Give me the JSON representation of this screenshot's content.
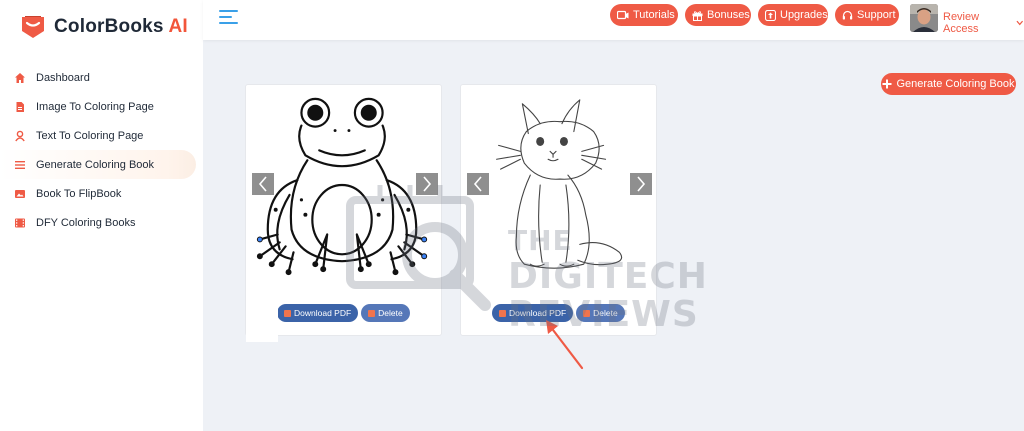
{
  "app": {
    "brand_main": "ColorBooks",
    "brand_accent": "AI",
    "accent_color": "#ef5a45"
  },
  "sidebar": {
    "items": [
      {
        "label": "Dashboard",
        "icon": "home-icon"
      },
      {
        "label": "Image To Coloring Page",
        "icon": "file-icon"
      },
      {
        "label": "Text To Coloring Page",
        "icon": "user-icon"
      },
      {
        "label": "Generate Coloring Book",
        "icon": "list-icon",
        "active": true
      },
      {
        "label": "Book To FlipBook",
        "icon": "image-icon"
      },
      {
        "label": "DFY Coloring Books",
        "icon": "film-icon"
      }
    ]
  },
  "topbar": {
    "tutorials": "Tutorials",
    "bonuses": "Bonuses",
    "upgrades": "Upgrades",
    "support": "Support",
    "user_name": "Review Access"
  },
  "main": {
    "generate_button": "Generate Coloring Book",
    "cards": [
      {
        "subject": "frog",
        "download": "Download PDF",
        "delete": "Delete"
      },
      {
        "subject": "cat",
        "download": "Download PDF",
        "delete": "Delete"
      }
    ]
  },
  "watermark": {
    "line1": "THE",
    "line2": "DIGITECH",
    "line3": "REVIEWS"
  }
}
